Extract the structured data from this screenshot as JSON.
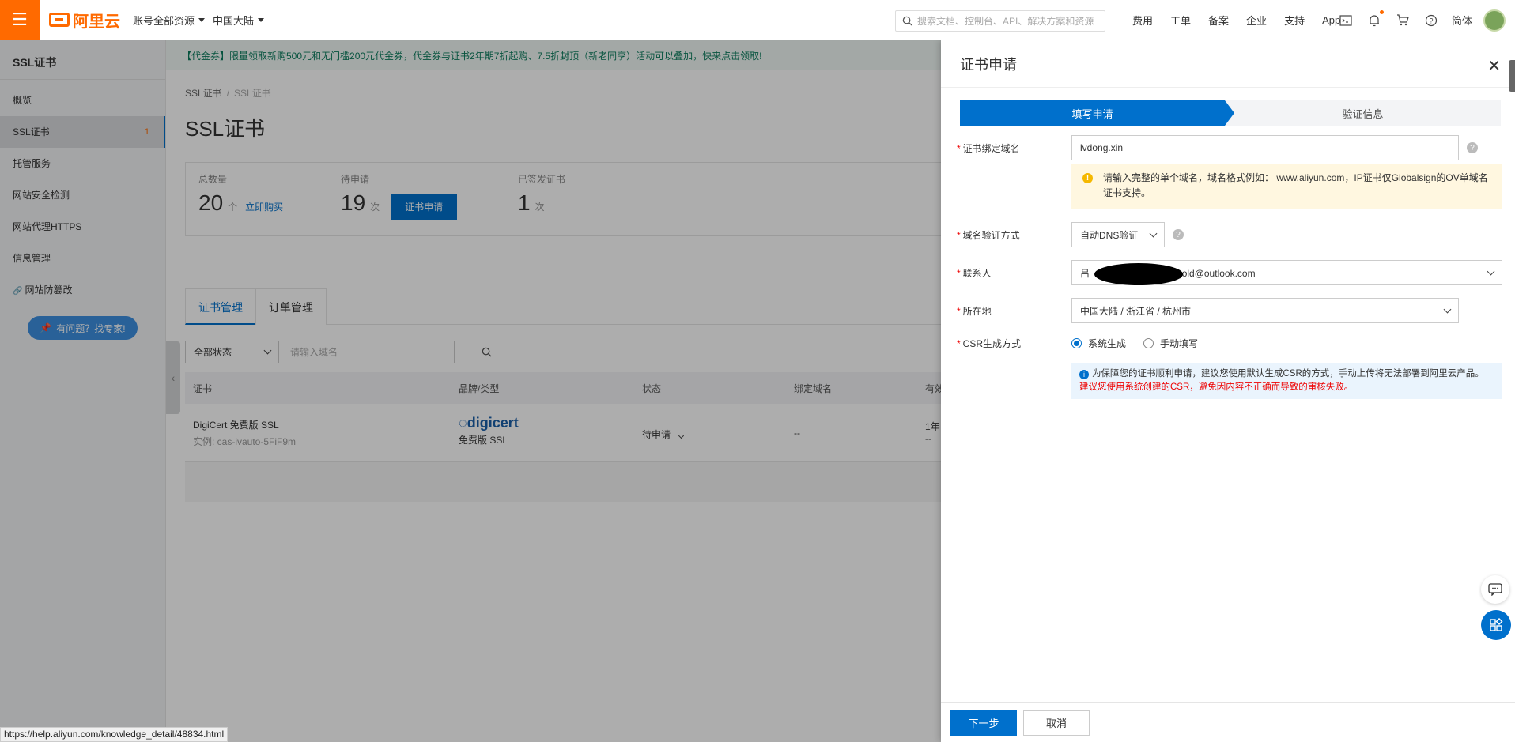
{
  "topbar": {
    "logo_text": "阿里云",
    "account_dd": "账号全部资源",
    "region_dd": "中国大陆",
    "search_placeholder": "搜索文档、控制台、API、解决方案和资源",
    "links": [
      "费用",
      "工单",
      "备案",
      "企业",
      "支持",
      "App"
    ],
    "lang": "简体"
  },
  "sidebar": {
    "title": "SSL证书",
    "items": [
      {
        "label": "概览"
      },
      {
        "label": "SSL证书",
        "badge": "1"
      },
      {
        "label": "托管服务"
      },
      {
        "label": "网站安全检测"
      },
      {
        "label": "网站代理HTTPS"
      },
      {
        "label": "信息管理"
      },
      {
        "label": "网站防篡改"
      }
    ],
    "help_btn": "有问题？找专家!"
  },
  "main": {
    "promo": "【代金券】限量领取新购500元和无门槛200元代金券，代金券与证书2年期7折起购、7.5折封顶（新老同享）活动可以叠加，快来点击领取!",
    "breadcrumb": [
      "SSL证书",
      "SSL证书"
    ],
    "page_title": "SSL证书",
    "stats": {
      "total_label": "总数量",
      "total_num": "20",
      "total_unit": "个",
      "buy_link": "立即购买",
      "pending_label": "待申请",
      "pending_num": "19",
      "pending_unit": "次",
      "apply_btn": "证书申请",
      "issued_label": "已签发证书",
      "issued_num": "1",
      "issued_unit": "次"
    },
    "tabs": [
      "证书管理",
      "订单管理"
    ],
    "filter": {
      "status": "全部状态",
      "domain_placeholder": "请输入域名"
    },
    "table": {
      "headers": [
        "证书",
        "品牌/类型",
        "状态",
        "绑定域名",
        "有效"
      ],
      "rows": [
        {
          "cert_name": "DigiCert 免费版 SSL",
          "instance": "实例: cas-ivauto-5FiF9m",
          "brand": "digicert",
          "type": "免费版 SSL",
          "status": "待申请",
          "domain": "--",
          "valid": "1年",
          "valid2": "--"
        }
      ]
    }
  },
  "drawer": {
    "title": "证书申请",
    "steps": [
      "填写申请",
      "验证信息"
    ],
    "domain_label": "证书绑定域名",
    "domain_value": "lvdong.xin",
    "domain_warn": "请输入完整的单个域名，域名格式例如： www.aliyun.com，IP证书仅Globalsign的OV单域名证书支持。",
    "verify_label": "域名验证方式",
    "verify_value": "自动DNS验证",
    "contact_label": "联系人",
    "contact_prefix": "吕",
    "contact_suffix": "gold@outlook.com",
    "location_label": "所在地",
    "location_value": "中国大陆 / 浙江省 / 杭州市",
    "csr_label": "CSR生成方式",
    "csr_options": [
      "系统生成",
      "手动填写"
    ],
    "csr_info": "为保障您的证书顺利申请，建议您使用默认生成CSR的方式，手动上传将无法部署到阿里云产品。",
    "csr_warn": "建议您使用系统创建的CSR，避免因内容不正确而导致的审核失败。",
    "next_btn": "下一步",
    "cancel_btn": "取消"
  },
  "status_url": "https://help.aliyun.com/knowledge_detail/48834.html"
}
